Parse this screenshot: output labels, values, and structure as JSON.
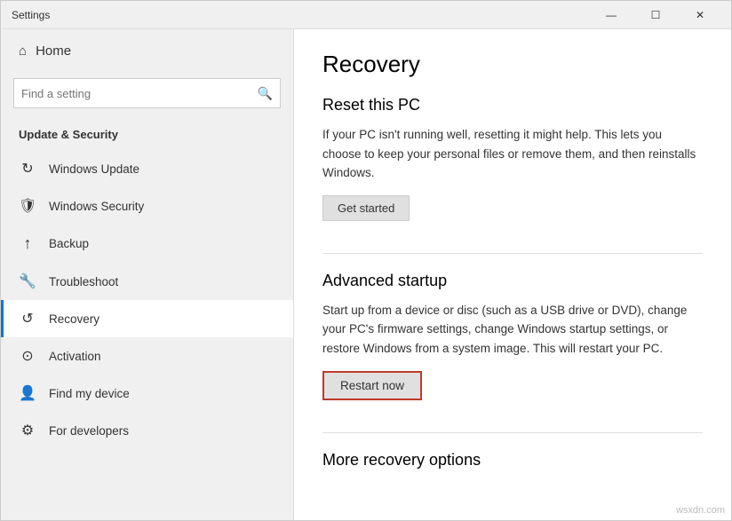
{
  "titleBar": {
    "title": "Settings",
    "minimizeLabel": "—",
    "maximizeLabel": "☐",
    "closeLabel": "✕"
  },
  "sidebar": {
    "homeLabel": "Home",
    "searchPlaceholder": "Find a setting",
    "searchIcon": "🔍",
    "sectionTitle": "Update & Security",
    "items": [
      {
        "id": "windows-update",
        "icon": "↻",
        "label": "Windows Update"
      },
      {
        "id": "windows-security",
        "icon": "🛡",
        "label": "Windows Security"
      },
      {
        "id": "backup",
        "icon": "↑",
        "label": "Backup"
      },
      {
        "id": "troubleshoot",
        "icon": "🔧",
        "label": "Troubleshoot"
      },
      {
        "id": "recovery",
        "icon": "↺",
        "label": "Recovery",
        "active": true
      },
      {
        "id": "activation",
        "icon": "⊙",
        "label": "Activation"
      },
      {
        "id": "find-my-device",
        "icon": "👤",
        "label": "Find my device"
      },
      {
        "id": "for-developers",
        "icon": "⚙",
        "label": "For developers"
      }
    ]
  },
  "main": {
    "pageTitle": "Recovery",
    "resetSection": {
      "title": "Reset this PC",
      "description": "If your PC isn't running well, resetting it might help. This lets you choose to keep your personal files or remove them, and then reinstalls Windows.",
      "buttonLabel": "Get started"
    },
    "advancedSection": {
      "title": "Advanced startup",
      "description": "Start up from a device or disc (such as a USB drive or DVD), change your PC's firmware settings, change Windows startup settings, or restore Windows from a system image. This will restart your PC.",
      "buttonLabel": "Restart now"
    },
    "moreSection": {
      "title": "More recovery options"
    }
  },
  "watermark": "wsxdn.com"
}
